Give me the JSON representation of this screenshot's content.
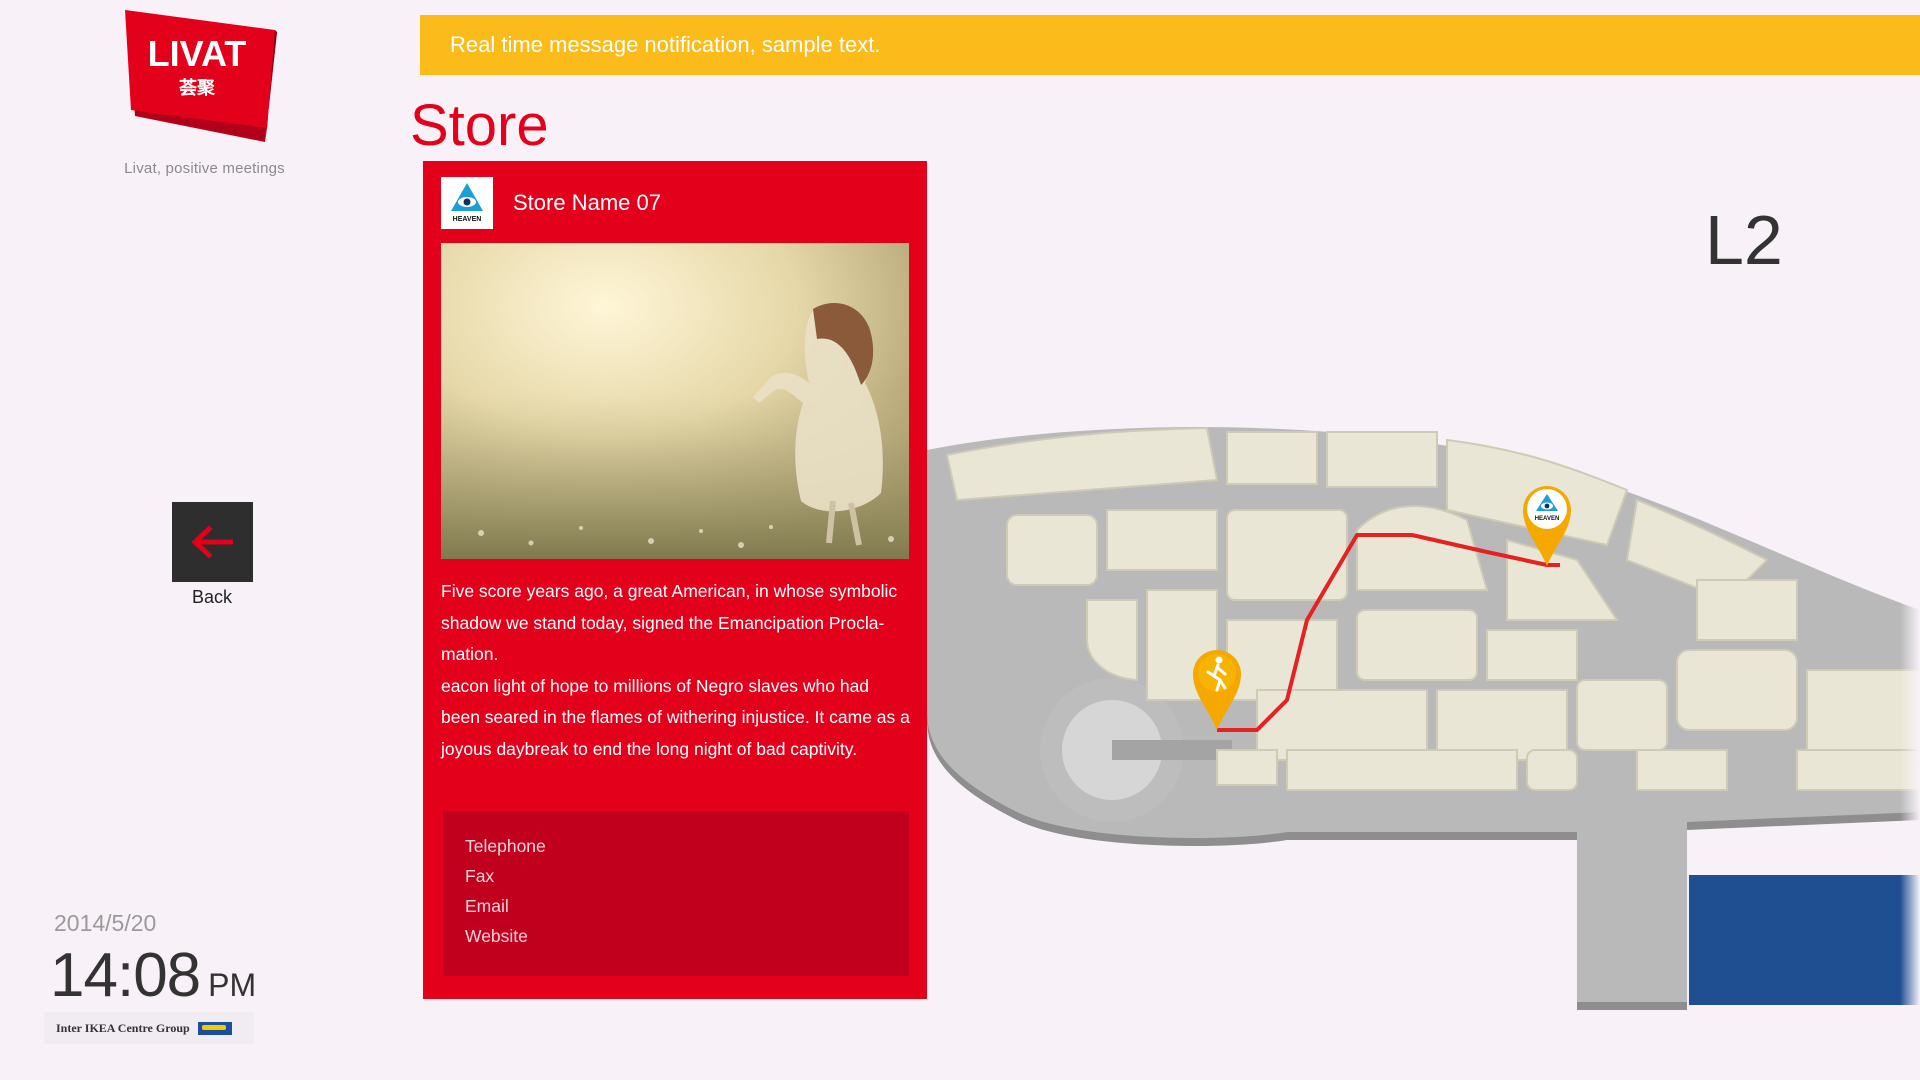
{
  "brand": {
    "logo_text": "LIVAT",
    "logo_subtext": "荟聚",
    "tagline": "Livat, positive meetings",
    "accent": "#e2001a",
    "notify_color": "#fbbb1b"
  },
  "notification": {
    "text": "Real time message notification, sample text."
  },
  "page": {
    "title": "Store",
    "level": "L2"
  },
  "nav": {
    "back_label": "Back",
    "back_icon": "arrow-left-icon"
  },
  "clock": {
    "date": "2014/5/20",
    "time": "14:08",
    "ampm": "PM"
  },
  "footer": {
    "company": "Inter IKEA Centre Group"
  },
  "store": {
    "name": "Store Name 07",
    "logo_text": "HEAVEN",
    "description": [
      "Five score years ago, a great American, in whose symbolic shadow we stand today, signed the Emancipation Procla-mation.",
      "eacon light of hope to millions of Negro slaves who had been seared in the flames of withering injustice. It came as a joyous daybreak to end the long night of bad captivity."
    ],
    "contact": [
      "Telephone",
      "Fax",
      "Email",
      "Website"
    ]
  },
  "map": {
    "start_marker_icon": "walking-person-icon",
    "destination_marker_icon": "store-logo-pin-icon",
    "destination_logo_text": "HEAVEN",
    "route_color": "#e52222"
  }
}
